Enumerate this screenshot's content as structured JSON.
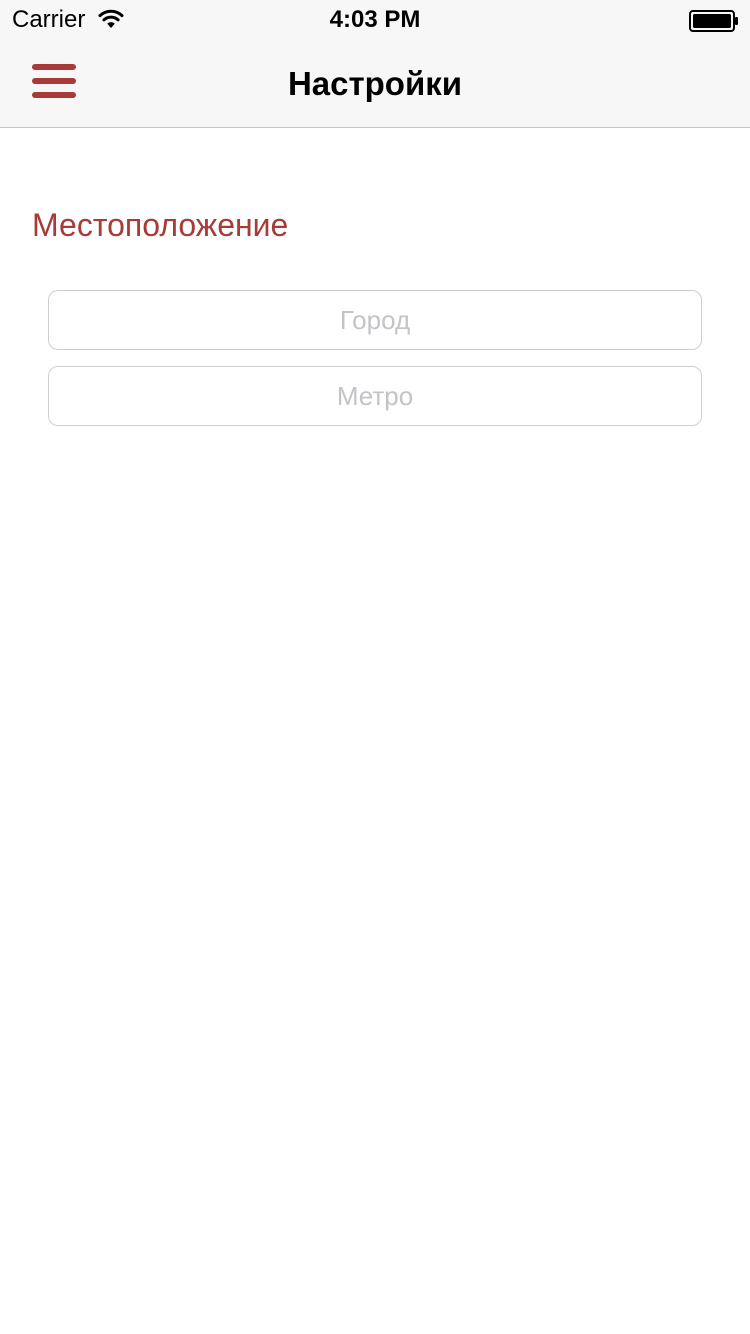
{
  "status_bar": {
    "carrier": "Carrier",
    "time": "4:03 PM",
    "icons": [
      "wifi-icon",
      "battery-icon"
    ]
  },
  "nav": {
    "title": "Настройки",
    "menu_icon": "hamburger-menu-icon"
  },
  "location": {
    "section_title": "Местоположение",
    "city": {
      "value": "",
      "placeholder": "Город"
    },
    "metro": {
      "value": "",
      "placeholder": "Метро"
    }
  },
  "colors": {
    "accent": "#a83b38",
    "navbar_bg": "#f7f7f7",
    "field_border": "#cfcfcf",
    "placeholder": "#c4c4c8",
    "background": "#ffffff"
  }
}
